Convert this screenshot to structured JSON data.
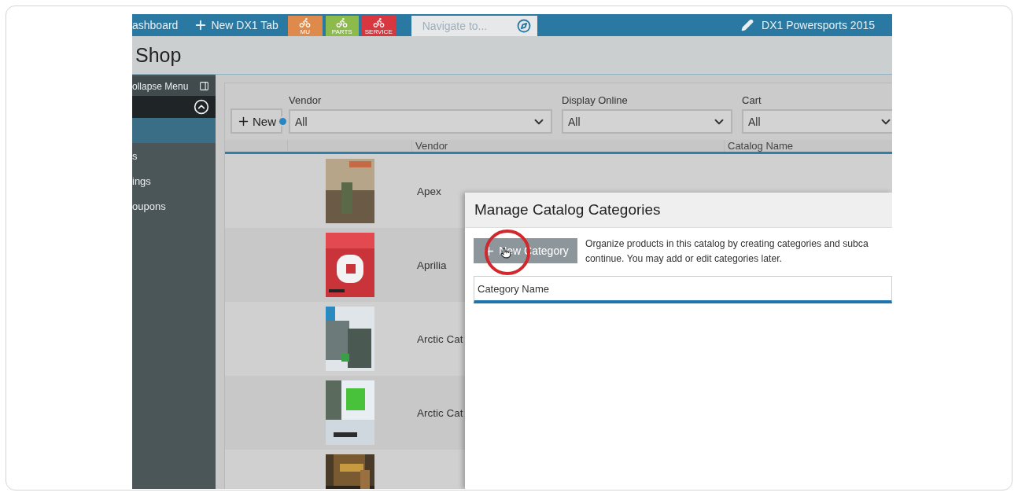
{
  "top_bar": {
    "links": [
      {
        "kind": "link",
        "label": "ashboard"
      },
      {
        "kind": "new_tab",
        "label": "New DX1 Tab"
      }
    ],
    "tiles": [
      {
        "label": "MU",
        "color": "#dd8a4c"
      },
      {
        "label": "PARTS",
        "color": "#8cbb4c"
      },
      {
        "label": "SERVICE",
        "color": "#d8373f"
      }
    ],
    "navigate": {
      "placeholder": "Navigate to..."
    },
    "dealer": "DX1 Powersports 2015"
  },
  "page_title": "Shop",
  "sidebar": {
    "collapse_label": "ollapse Menu",
    "items": [
      {
        "selected": true
      },
      {
        "label": "s",
        "selected": false
      },
      {
        "label": "ings",
        "selected": false
      },
      {
        "label": "oupons",
        "selected": false
      }
    ]
  },
  "filters": {
    "new_button": "New",
    "fields": [
      {
        "label": "Vendor",
        "value": "All"
      },
      {
        "label": "Display Online",
        "value": "All"
      },
      {
        "label": "Cart",
        "value": "All"
      }
    ]
  },
  "table": {
    "columns": [
      {
        "label": "Vendor"
      },
      {
        "label": "Catalog Name"
      }
    ],
    "rows": [
      {
        "vendor": "Apex",
        "cover": {
          "kind": "picture"
        }
      },
      {
        "vendor": "Aprilia",
        "cover": {
          "kind": "picture"
        }
      },
      {
        "vendor": "Arctic Cat",
        "cover": {
          "kind": "picture"
        }
      },
      {
        "vendor": "Arctic Cat",
        "cover": {
          "kind": "picture"
        }
      },
      {
        "cover": {
          "kind": "picture"
        }
      }
    ]
  },
  "modal": {
    "title": "Manage Catalog Categories",
    "new_category_button": "New Category",
    "description_lines": [
      "Organize products in this catalog by creating categories and subca",
      "continue. You may add or edit categories later."
    ],
    "column": "Category Name"
  }
}
